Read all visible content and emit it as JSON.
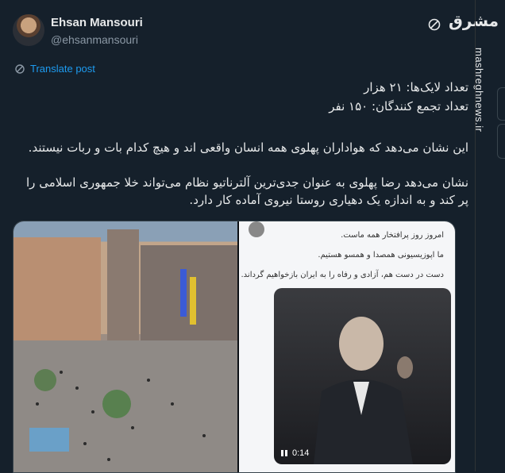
{
  "author": {
    "name": "Ehsan Mansouri",
    "handle": "@ehsanmansouri"
  },
  "brand": {
    "logo_text": "مشرق",
    "site": "mashreghnews.ir"
  },
  "translate_label": "Translate post",
  "tweet": {
    "line1": "تعداد لایک‌ها: ۲۱ هزار",
    "line2": "تعداد تجمع کنندگان: ۱۵۰ نفر",
    "para1": "این نشان می‌دهد که هواداران پهلوی همه انسان واقعی اند و هیچ کدام بات و ربات نیستند.",
    "para2": "نشان می‌دهد رضا پهلوی به عنوان جدی‌ترین آلترناتیو نظام می‌تواند خلا جمهوری اسلامی را پر کند و به اندازه یک دهیاری روستا نیروی آماده کار دارد."
  },
  "screenshot_post": {
    "msg1": "امروز روز پرافتخار همه ماست.",
    "msg2": "ما اپوزیسیونی همصدا و همسو هستیم.",
    "msg3": "دست در دست هم، آزادی و رفاه را به ایران بازخواهیم گرداند.",
    "video_time": "0:14"
  },
  "colors": {
    "background": "#15202b",
    "link": "#1d9bf0",
    "muted": "#8b98a5"
  },
  "icons": [
    "slash-circle-icon",
    "translate-icon",
    "pause-icon"
  ]
}
